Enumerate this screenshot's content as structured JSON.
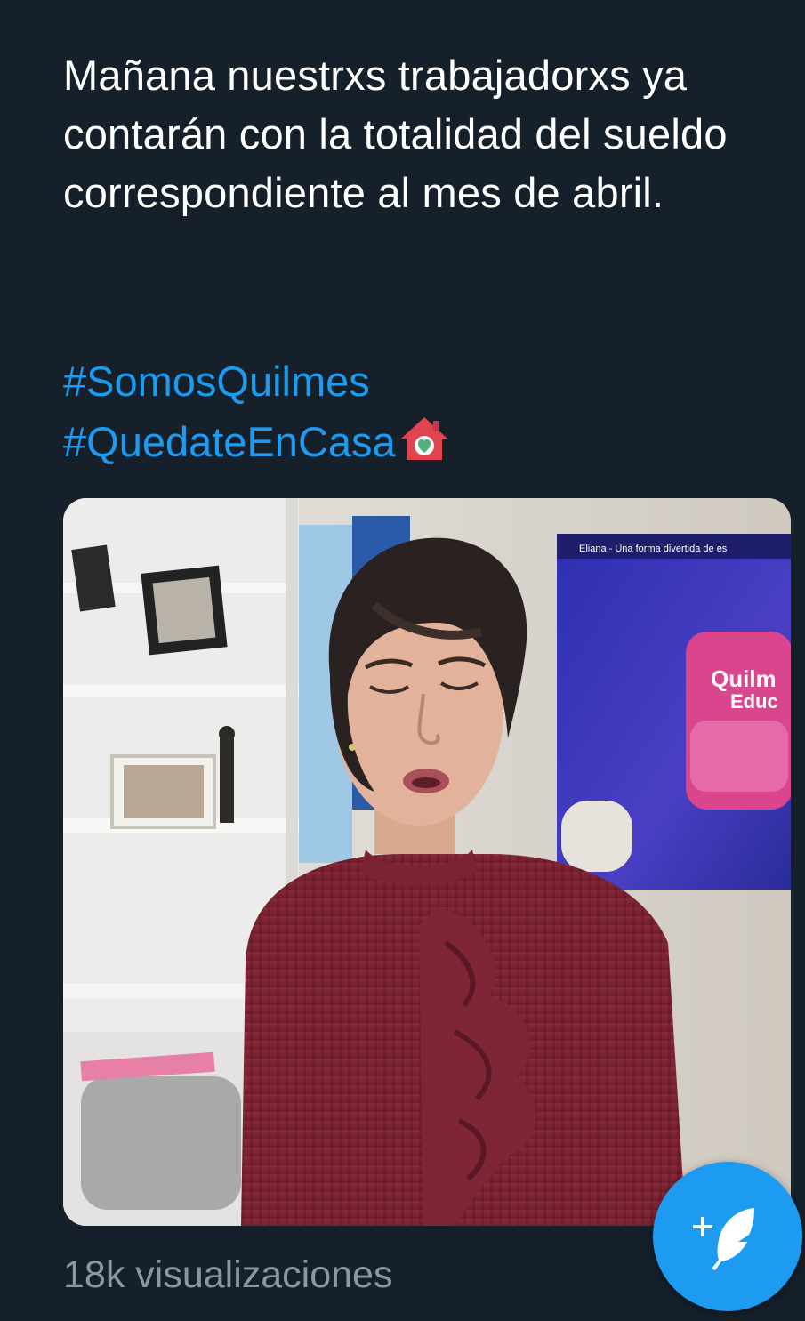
{
  "tweet": {
    "text": "Mañana nuestrxs trabajadorxs ya contarán con la totalidad del sueldo correspondiente al mes de abril.",
    "hashtags": [
      "#SomosQuilmes",
      "#QuedateEnCasa"
    ],
    "emoji": "house-with-heart-globe-emoji"
  },
  "media": {
    "type": "video",
    "screen_text": {
      "line1": "Quilm",
      "line2": "Educ",
      "banner": "Eliana - Una forma divertida de es"
    }
  },
  "footer": {
    "views": "18k visualizaciones"
  },
  "compose_button": {
    "icon": "compose-tweet-icon"
  },
  "colors": {
    "background": "#15202b",
    "text": "#ffffff",
    "hashtag": "#1d9bf0",
    "muted": "#8899a6",
    "fab": "#1d9bf0"
  }
}
